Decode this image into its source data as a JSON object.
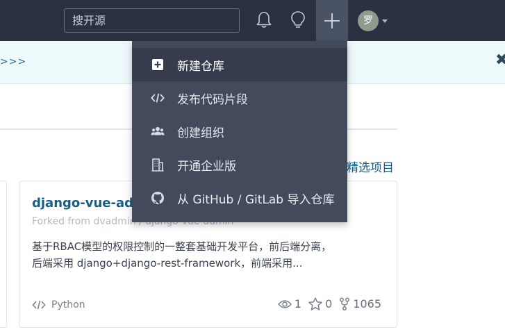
{
  "header": {
    "search_placeholder": "搜开源",
    "avatar_text": "罗"
  },
  "notice": {
    "link_text": ">>>",
    "close_text": "✖"
  },
  "main": {
    "featured_link": "精选项目"
  },
  "repo": {
    "title": "django-vue-admin",
    "forked_from": "Forked from dvadmin / django-vue-admin",
    "description_line1": "基于RBAC模型的权限控制的一整套基础开发平台，前后端分离，",
    "description_line2": "后端采用 django+django-rest-framework，前端采用...",
    "language": "Python",
    "watchers": "1",
    "stars": "0",
    "forks": "1065"
  },
  "create_menu": {
    "items": [
      {
        "label": "新建仓库",
        "icon": "plus-square-icon"
      },
      {
        "label": "发布代码片段",
        "icon": "code-icon"
      },
      {
        "label": "创建组织",
        "icon": "users-icon"
      },
      {
        "label": "开通企业版",
        "icon": "building-icon"
      },
      {
        "label": "从 GitHub / GitLab 导入仓库",
        "icon": "github-icon"
      }
    ]
  },
  "colors": {
    "navbar": "#2b3141",
    "menu_bg": "#434a5c",
    "menu_active": "#363c4d",
    "link": "#175d86"
  }
}
